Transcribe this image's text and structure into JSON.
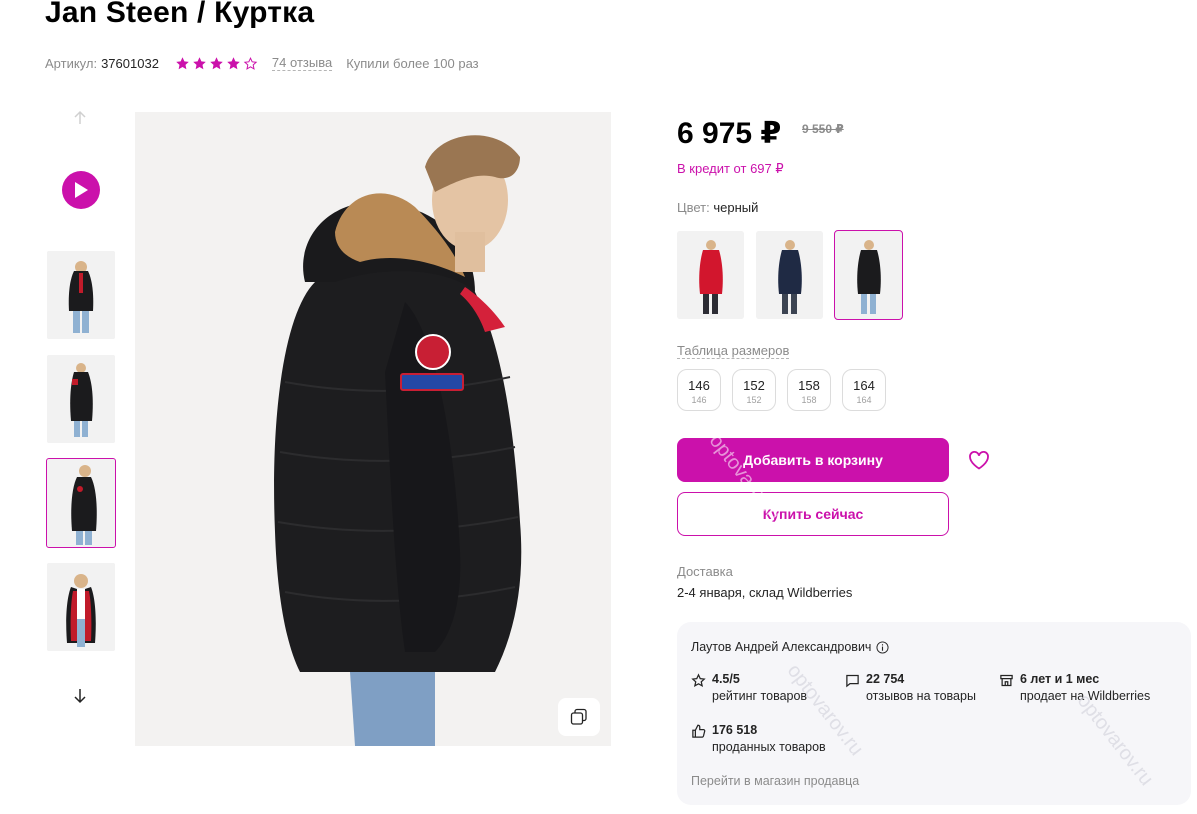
{
  "product": {
    "title": "Jan Steen / Куртка",
    "sku_label": "Артикул:",
    "sku_value": "37601032",
    "rating_stars": 4,
    "rating_max": 5,
    "reviews_text": "74 отзыва",
    "bought_text": "Купили более 100 раз"
  },
  "gallery": {
    "thumbnails": [
      "thumb-1",
      "thumb-2",
      "thumb-3",
      "thumb-4"
    ],
    "active_index": 2,
    "accent_color": "#cb11ab"
  },
  "pricing": {
    "price": "6 975 ₽",
    "old_price": "9 550 ₽",
    "credit": "В кредит от 697 ₽"
  },
  "color": {
    "label": "Цвет:",
    "value": "черный",
    "options": [
      "red",
      "navy",
      "black"
    ],
    "selected_index": 2
  },
  "sizes": {
    "table_link": "Таблица размеров",
    "items": [
      {
        "size": "146",
        "ru": "146"
      },
      {
        "size": "152",
        "ru": "152"
      },
      {
        "size": "158",
        "ru": "158"
      },
      {
        "size": "164",
        "ru": "164"
      }
    ]
  },
  "actions": {
    "add_to_cart": "Добавить в корзину",
    "buy_now": "Купить сейчас"
  },
  "delivery": {
    "label": "Доставка",
    "value": "2-4 января, склад Wildberries"
  },
  "seller": {
    "name": "Лаутов Андрей Александрович",
    "rating_value": "4.5/5",
    "rating_label": "рейтинг товаров",
    "reviews_value": "22 754",
    "reviews_label": "отзывов на товары",
    "tenure_value": "6 лет и 1 мес",
    "tenure_label": "продает на Wildberries",
    "sold_value": "176 518",
    "sold_label": "проданных товаров",
    "store_link": "Перейти в магазин продавца"
  },
  "watermark": "optovarov.ru"
}
